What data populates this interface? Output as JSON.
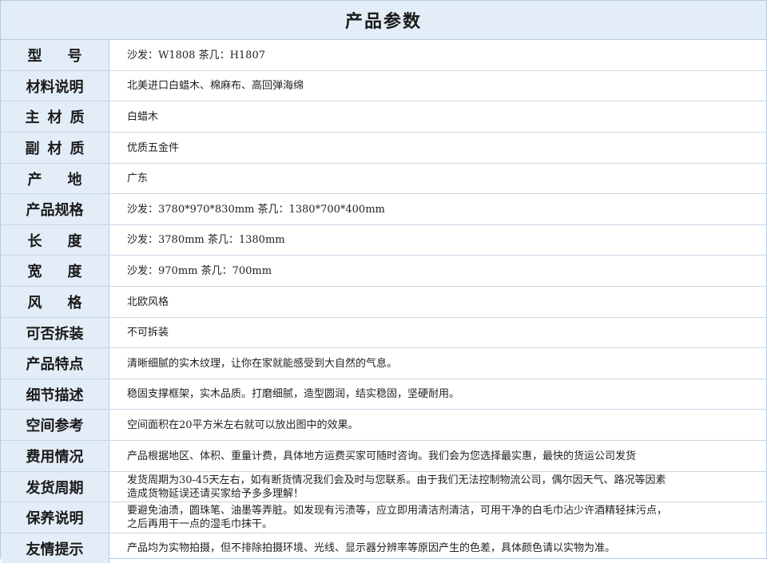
{
  "title": "产品参数",
  "rows": [
    {
      "label": "型号",
      "value": "沙发：W1808  茶几：H1807"
    },
    {
      "label": "材料说明",
      "value": "北美进口白蜡木、棉麻布、高回弹海绵"
    },
    {
      "label": "主材质",
      "value": "白蜡木"
    },
    {
      "label": "副材质",
      "value": "优质五金件"
    },
    {
      "label": "产地",
      "value": "广东"
    },
    {
      "label": "产品规格",
      "value": "沙发：3780*970*830mm  茶几：1380*700*400mm"
    },
    {
      "label": "长度",
      "value": "沙发：3780mm  茶几：1380mm"
    },
    {
      "label": "宽度",
      "value": "沙发：970mm  茶几：700mm"
    },
    {
      "label": "风格",
      "value": "北欧风格"
    },
    {
      "label": "可否拆装",
      "value": "不可拆装"
    },
    {
      "label": "产品特点",
      "value": "清晰细腻的实木纹理，让你在家就能感受到大自然的气息。"
    },
    {
      "label": "细节描述",
      "value": "稳固支撑框架，实木品质。打磨细腻，造型圆润，结实稳固，坚硬耐用。"
    },
    {
      "label": "空间参考",
      "value": "空间面积在20平方米左右就可以放出图中的效果。"
    },
    {
      "label": "费用情况",
      "value": "产品根据地区、体积、重量计费，具体地方运费买家可随时咨询。我们会为您选择最实惠，最快的货运公司发货"
    },
    {
      "label": "发货周期",
      "value": "发货周期为30-45天左右，如有断货情况我们会及时与您联系。由于我们无法控制物流公司，偶尔因天气、路况等因素\n造成货物延误还请买家给予多多理解！"
    },
    {
      "label": "保养说明",
      "value": "要避免油渍，圆珠笔、油墨等弄脏。如发现有污渍等，应立即用清洁剂清洁，可用干净的白毛巾沾少许酒精轻抹污点，\n之后再用干一点的湿毛巾抹干。"
    },
    {
      "label": "友情提示",
      "value": "产品均为实物拍摄，但不排除拍摄环境、光线、显示器分辨率等原因产生的色差，具体颜色请以实物为准。"
    }
  ]
}
